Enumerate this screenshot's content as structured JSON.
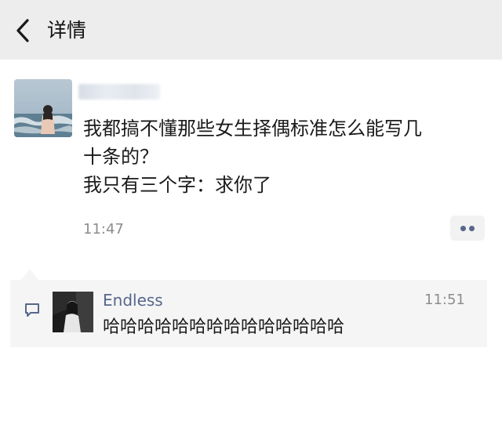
{
  "nav": {
    "back_icon": "chevron-left-icon",
    "title": "详情"
  },
  "post": {
    "author_name_visible": false,
    "text_lines": [
      "我都搞不懂那些女生择偶标准怎么能写几",
      "十条的？",
      "我只有三个字：求你了"
    ],
    "time": "11:47",
    "more_icon": "two-dots-icon"
  },
  "comments": [
    {
      "icon": "comment-bubble-icon",
      "name": "Endless",
      "time": "11:51",
      "text": "哈哈哈哈哈哈哈哈哈哈哈哈哈哈"
    }
  ],
  "colors": {
    "nav_bg": "#ededed",
    "link_blue": "#56678a",
    "muted": "#8c8c8c",
    "comment_bg": "#f5f5f5"
  }
}
